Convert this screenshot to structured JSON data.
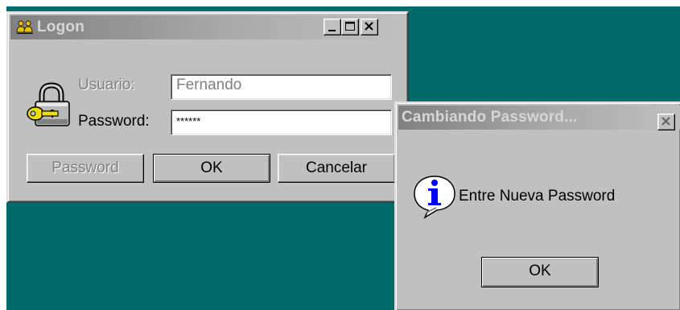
{
  "colors": {
    "desktop": "#006b6b",
    "face": "#c0c0c0",
    "title_inactive_start": "#808080",
    "info_icon": "#0000ff"
  },
  "logon": {
    "title": "Logon",
    "app_icon": "users-icon",
    "caption_buttons": [
      "minimize-icon",
      "maximize-icon",
      "close-icon"
    ],
    "lock_icon": "padlock-key-icon",
    "user_label": "Usuario:",
    "user_value": "Fernando",
    "password_label": "Password:",
    "password_value": "******",
    "buttons": {
      "password": "Password",
      "ok": "OK",
      "cancel": "Cancelar"
    }
  },
  "dialog": {
    "title": "Cambiando Password...",
    "close_icon": "close-icon",
    "icon": "info-icon",
    "message": "Entre Nueva Password",
    "ok": "OK"
  }
}
